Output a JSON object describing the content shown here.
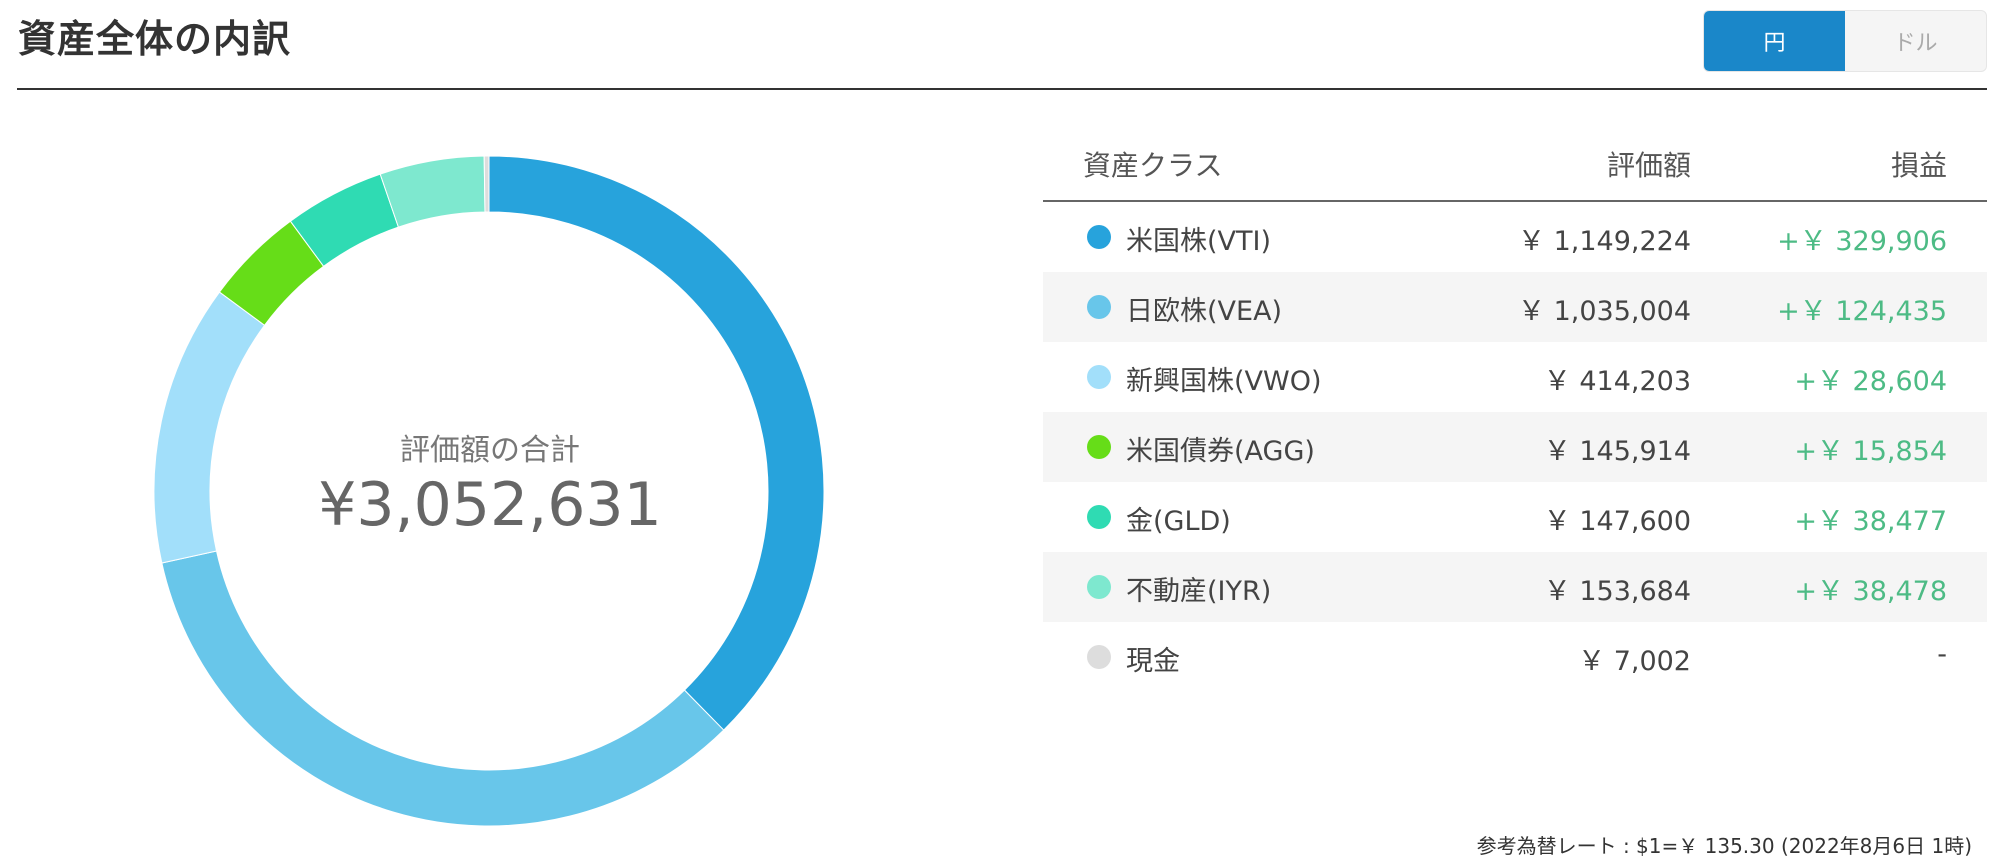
{
  "header": {
    "title": "資産全体の内訳",
    "currency_toggle": {
      "options": [
        "円",
        "ドル"
      ],
      "selected": "円"
    }
  },
  "summary": {
    "label": "評価額の合計",
    "total": "¥3,052,631"
  },
  "table": {
    "headers": {
      "asset_class": "資産クラス",
      "value": "評価額",
      "profit_loss": "損益"
    },
    "rows": [
      {
        "name": "米国株(VTI)",
        "value": "￥ 1,149,224",
        "pl": "+￥ 329,906",
        "color": "#27a3dc"
      },
      {
        "name": "日欧株(VEA)",
        "value": "￥ 1,035,004",
        "pl": "+￥ 124,435",
        "color": "#68c6ea"
      },
      {
        "name": "新興国株(VWO)",
        "value": "￥ 414,203",
        "pl": "+￥ 28,604",
        "color": "#a2dffa"
      },
      {
        "name": "米国債券(AGG)",
        "value": "￥ 145,914",
        "pl": "+￥ 15,854",
        "color": "#66dd18"
      },
      {
        "name": "金(GLD)",
        "value": "￥ 147,600",
        "pl": "+￥ 38,477",
        "color": "#2fdbb3"
      },
      {
        "name": "不動産(IYR)",
        "value": "￥ 153,684",
        "pl": "+￥ 38,478",
        "color": "#7ee8cf"
      },
      {
        "name": "現金",
        "value": "￥ 7,002",
        "pl": "-",
        "color": "#dddddd"
      }
    ]
  },
  "fx_note": "参考為替レート : $1=￥ 135.30 (2022年8月6日 1時)",
  "chart_data": {
    "type": "pie",
    "variant": "donut",
    "categories": [
      "米国株(VTI)",
      "日欧株(VEA)",
      "新興国株(VWO)",
      "米国債券(AGG)",
      "金(GLD)",
      "不動産(IYR)",
      "現金"
    ],
    "values": [
      1149224,
      1035004,
      414203,
      145914,
      147600,
      153684,
      7002
    ],
    "colors": [
      "#27a3dc",
      "#68c6ea",
      "#a2dffa",
      "#66dd18",
      "#2fdbb3",
      "#7ee8cf",
      "#dddddd"
    ],
    "start": "top",
    "direction": "clockwise"
  }
}
